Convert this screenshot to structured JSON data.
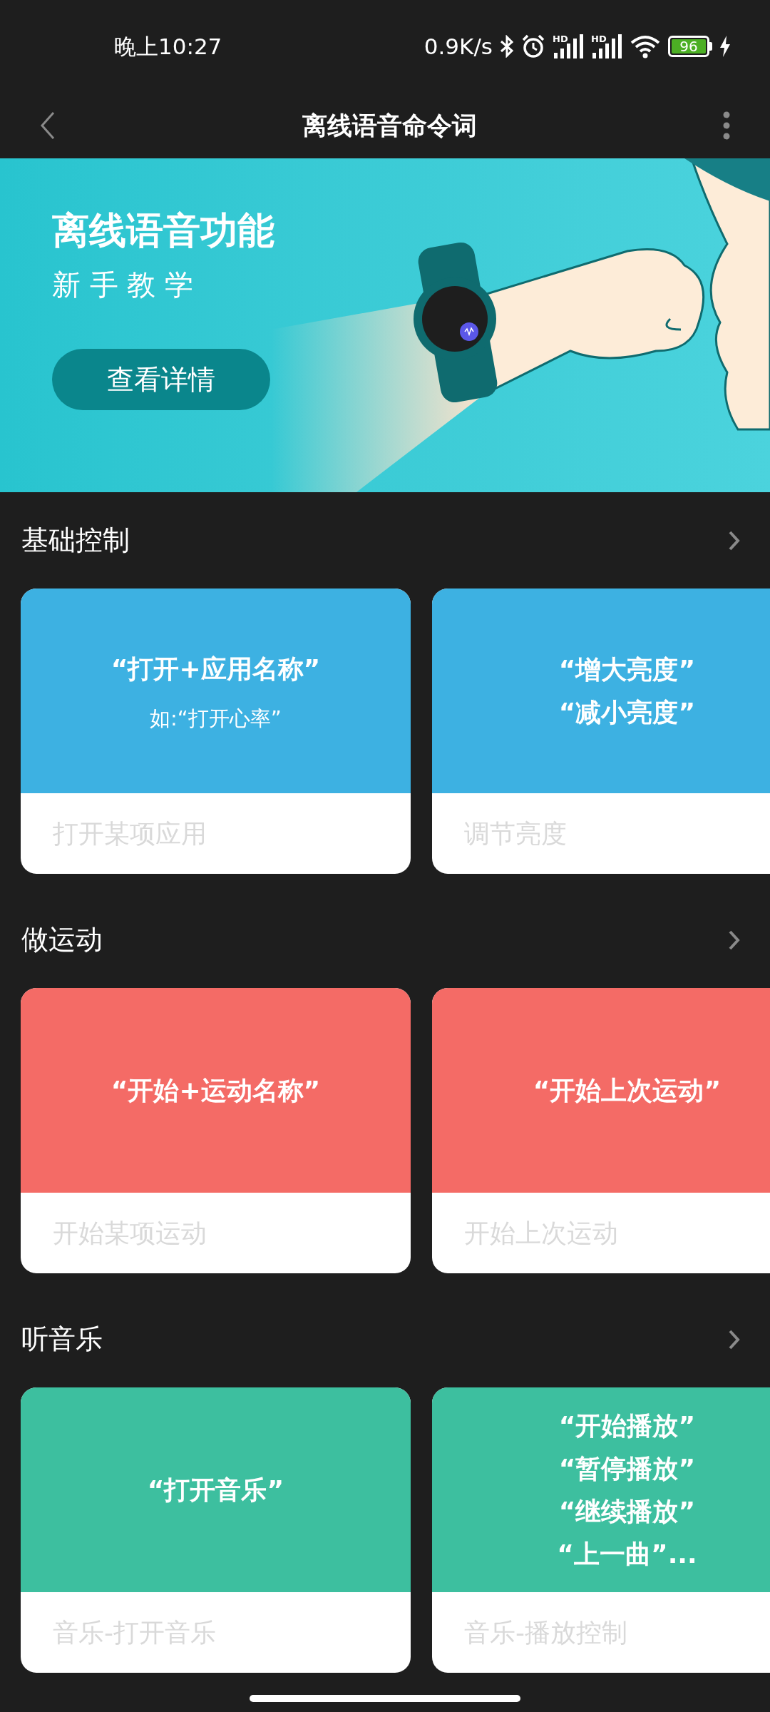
{
  "status_bar": {
    "time": "晚上10:27",
    "speed": "0.9K/s",
    "signal_labels": [
      "HD",
      "HD"
    ],
    "battery": "96",
    "charging": true
  },
  "header": {
    "title": "离线语音命令词"
  },
  "banner": {
    "title": "离线语音功能",
    "subtitle": "新 手 教 学",
    "button": "查看详情"
  },
  "sections": [
    {
      "title": "基础控制",
      "color": "#3db1e2",
      "cards": [
        {
          "lines": [
            "“打开+应用名称”"
          ],
          "example": "如:“打开心率”",
          "label": "打开某项应用"
        },
        {
          "lines": [
            "“增大亮度”",
            "“减小亮度”"
          ],
          "label": "调节亮度"
        }
      ]
    },
    {
      "title": "做运动",
      "color": "#f46b66",
      "cards": [
        {
          "lines": [
            "“开始+运动名称”"
          ],
          "label": "开始某项运动"
        },
        {
          "lines": [
            "“开始上次运动”"
          ],
          "label": "开始上次运动"
        }
      ]
    },
    {
      "title": "听音乐",
      "color": "#3dbf9f",
      "cards": [
        {
          "lines": [
            "“打开音乐”"
          ],
          "label": "音乐-打开音乐"
        },
        {
          "lines": [
            "“开始播放”",
            "“暂停播放”",
            "“继续播放”",
            "“上一曲”..."
          ],
          "label": "音乐-播放控制"
        }
      ]
    }
  ]
}
